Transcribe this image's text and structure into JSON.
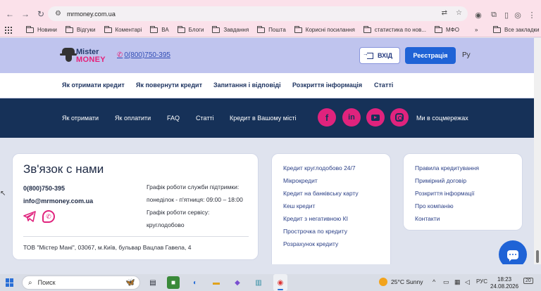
{
  "browser": {
    "url": "mrmoney.com.ua",
    "bookmarks": [
      "Новини",
      "Відгуки",
      "Коментарі",
      "ВА",
      "Блоги",
      "Завдання",
      "Пошта",
      "Корисні посилання",
      "статистика по нов...",
      "МФО"
    ],
    "more": "»",
    "all_bookmarks": "Все закладки"
  },
  "header": {
    "logo_line1": "Mister",
    "logo_line2": "MONEY",
    "phone": "0(800)750-395",
    "login_label": "ВХІД",
    "register_label": "Реєстрація",
    "lang": "Ру"
  },
  "topnav": [
    "Як отримати кредит",
    "Як повернути кредит",
    "Запитання і відповіді",
    "Розкриття інформація",
    "Статті"
  ],
  "footer_nav": {
    "items": [
      "Як отримати",
      "Як оплатити",
      "FAQ",
      "Статті",
      "Кредит в Вашому місті"
    ],
    "social_label": "Ми в соцмережах",
    "social_icons": [
      "facebook-icon",
      "linkedin-icon",
      "youtube-icon",
      "instagram-icon"
    ]
  },
  "contact": {
    "title": "Зв'язок с нами",
    "phone": "0(800)750-395",
    "email": "info@mrmoney.com.ua",
    "schedule": [
      "Графік роботи служби підтримки:",
      "понеділок - п'ятниця: 09:00 – 18:00",
      "Графік роботи сервісу:",
      "круглодобово"
    ],
    "address": "ТОВ \"Містер Мані\", 03067, м.Київ, бульвар Вацлав Гавела, 4"
  },
  "links_col1": [
    "Кредит круглодобово 24/7",
    "Мікрокредит",
    "Кредит на банківську карту",
    "Кеш кредит",
    "Кредит з негативною КІ",
    "Прострочка по кредиту",
    "Розрахунок кредиту"
  ],
  "links_col2": [
    "Правила кредитування",
    "Примірний договір",
    "Розкриття інформації",
    "Про компанію",
    "Контакти"
  ],
  "taskbar": {
    "search_placeholder": "Поиск",
    "weather": "25°C  Sunny",
    "lang": "РУС",
    "time": "18:23",
    "date": "24.08.2026",
    "notifications": "20"
  },
  "colors": {
    "accent_pink": "#e0237d",
    "primary_blue": "#1f63d6",
    "navy": "#163158"
  }
}
